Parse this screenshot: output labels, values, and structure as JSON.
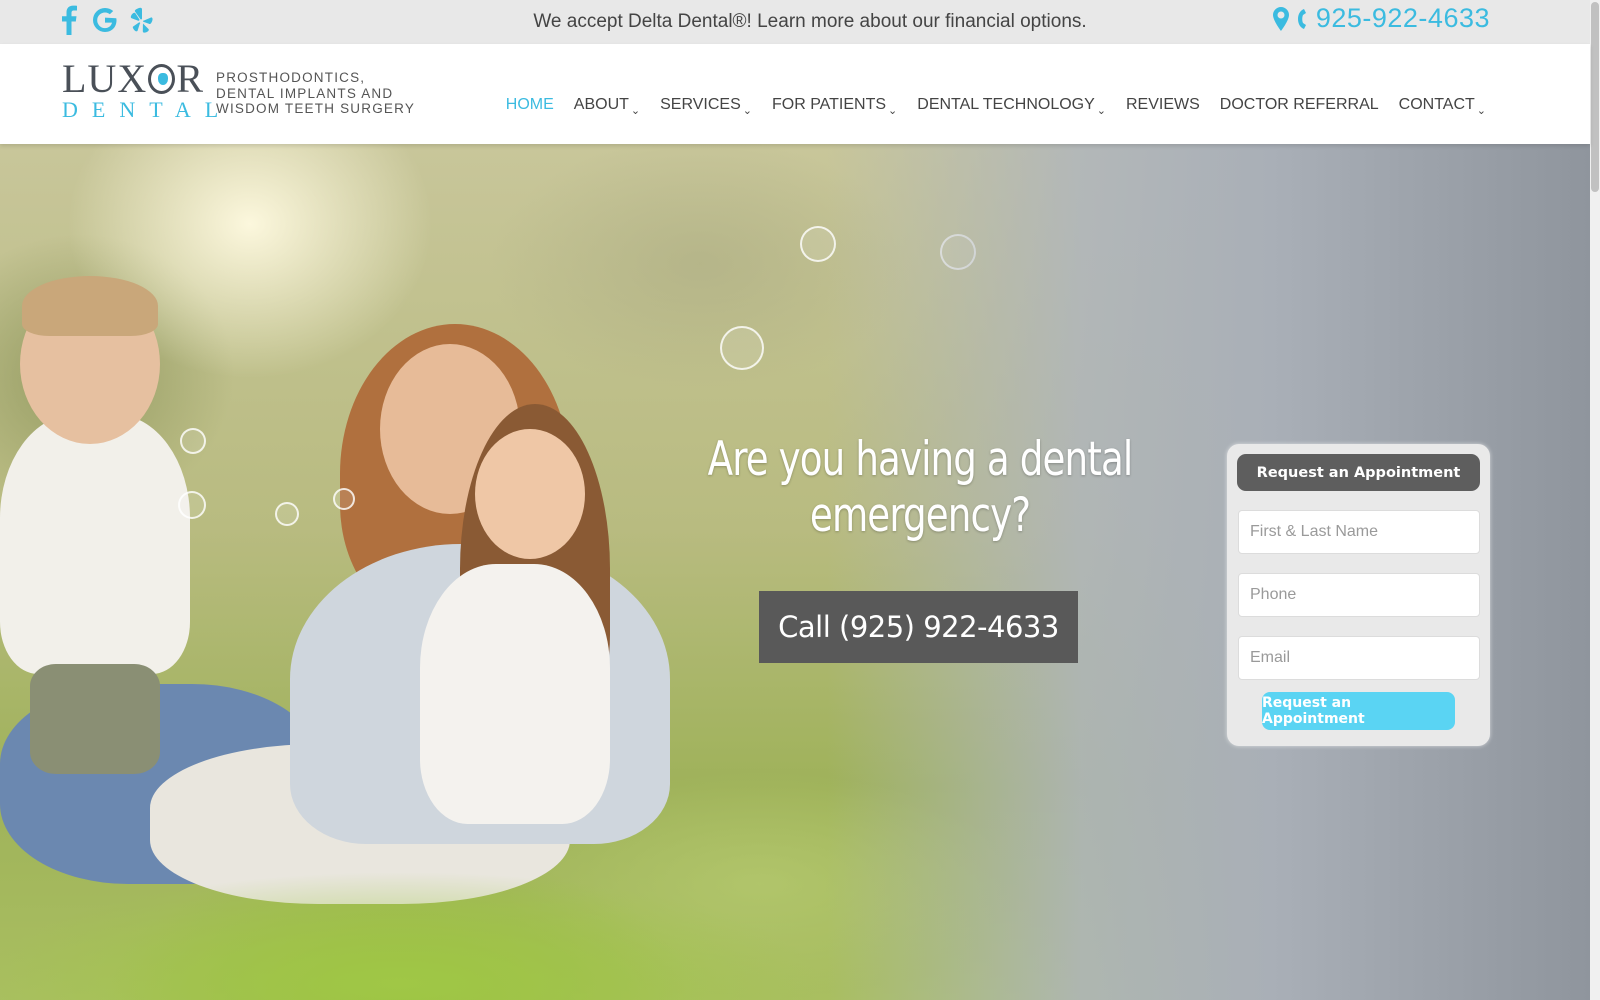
{
  "topbar": {
    "social": [
      {
        "name": "facebook-icon"
      },
      {
        "name": "google-icon"
      },
      {
        "name": "yelp-icon"
      }
    ],
    "notice": "We accept Delta Dental®! Learn more about our financial options.",
    "phone": "925-922-4633"
  },
  "logo": {
    "word_top_1": "LUX",
    "word_top_2": "R",
    "word_bottom": "DENTAL",
    "tagline_1": "Prosthodontics,",
    "tagline_2": "Dental Implants and",
    "tagline_3": "Wisdom Teeth Surgery"
  },
  "nav": {
    "items": [
      {
        "label": "HOME",
        "active": true,
        "dropdown": false
      },
      {
        "label": "ABOUT",
        "active": false,
        "dropdown": true
      },
      {
        "label": "SERVICES",
        "active": false,
        "dropdown": true
      },
      {
        "label": "FOR PATIENTS",
        "active": false,
        "dropdown": true
      },
      {
        "label": "DENTAL TECHNOLOGY",
        "active": false,
        "dropdown": true
      },
      {
        "label": "REVIEWS",
        "active": false,
        "dropdown": false
      },
      {
        "label": "DOCTOR REFERRAL",
        "active": false,
        "dropdown": false
      },
      {
        "label": "CONTACT",
        "active": false,
        "dropdown": true
      }
    ]
  },
  "hero": {
    "headline_1": "Are you having a dental",
    "headline_2": "emergency?",
    "call_button": "Call (925) 922-4633"
  },
  "form": {
    "title": "Request an Appointment",
    "name_placeholder": "First & Last Name",
    "phone_placeholder": "Phone",
    "email_placeholder": "Email",
    "submit": "Request an Appointment"
  },
  "colors": {
    "accent": "#3bbbe0",
    "button_dark": "#595959",
    "submit": "#5ad4f3"
  }
}
